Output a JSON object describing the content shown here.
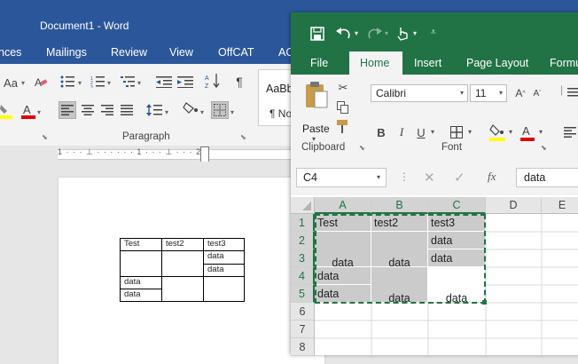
{
  "word": {
    "title": "Document1  -  Word",
    "tabs": [
      "nces",
      "Mailings",
      "Review",
      "View",
      "OffCAT",
      "AC"
    ],
    "group_label": "Paragraph",
    "styles": {
      "s1": "AaBb",
      "s2": "¶ No"
    },
    "ruler": "1 · · · ⊥ · · · · · · 1 · · · ⊥ · · · 2",
    "table": {
      "rows": [
        [
          "Test",
          "test2",
          "test3"
        ],
        [
          "",
          "",
          "data"
        ],
        [
          "",
          "",
          "data"
        ],
        [
          "data",
          "",
          ""
        ],
        [
          "data",
          "",
          ""
        ]
      ]
    }
  },
  "excel": {
    "tabs": {
      "file": "File",
      "home": "Home",
      "insert": "Insert",
      "page_layout": "Page Layout",
      "formulas": "Formu"
    },
    "clipboard": {
      "paste_label": "Paste",
      "group_label": "Clipboard"
    },
    "font": {
      "name": "Calibri",
      "size": "11",
      "group_label": "Font",
      "bold": "B",
      "italic": "I",
      "underline": "U"
    },
    "name_box": "C4",
    "formula_value": "data",
    "columns": [
      "A",
      "B",
      "C",
      "D",
      "E"
    ],
    "rows": [
      "1",
      "2",
      "3",
      "4",
      "5",
      "6",
      "7",
      "8"
    ],
    "cells": {
      "A1": "Test",
      "B1": "test2",
      "C1": "test3",
      "C2": "data",
      "A3": "data",
      "B3": "data",
      "C3": "data",
      "A4": "data",
      "A5": "data",
      "B5": "data",
      "C5": "data"
    },
    "colors": {
      "accent": "#217346",
      "word_accent": "#2b579a",
      "selection_shade": "#cbcbcb"
    }
  }
}
